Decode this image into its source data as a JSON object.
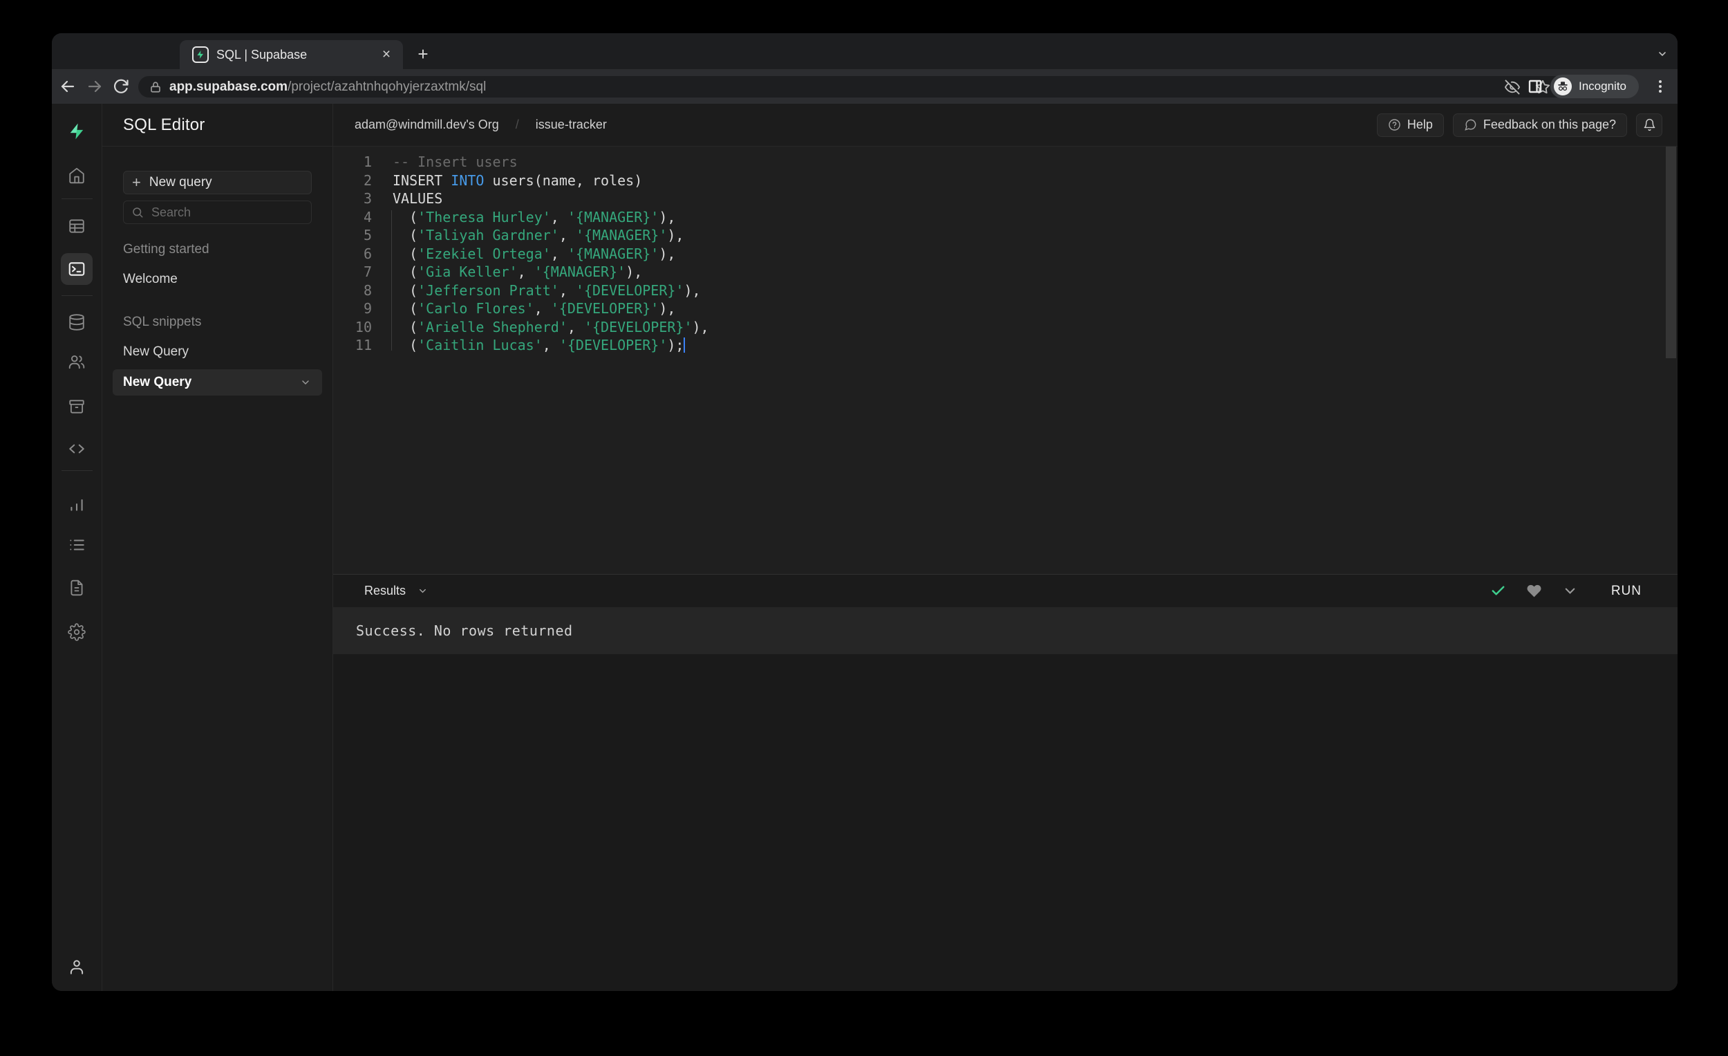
{
  "colors": {
    "accent": "#3ecf8e",
    "keyword_blue": "#479ae8",
    "string_green": "#35a77c",
    "caret_blue": "#3b82f6"
  },
  "browser": {
    "tab_title": "SQL | Supabase",
    "close_tab_glyph": "×",
    "new_tab_glyph": "+",
    "url_domain": "app.supabase.com",
    "url_path": "/project/azahtnhqohyjerzaxtmk/sql",
    "incognito_label": "Incognito"
  },
  "header": {
    "breadcrumb_org": "adam@windmill.dev's Org",
    "breadcrumb_separator": "/",
    "breadcrumb_project": "issue-tracker",
    "help_label": "Help",
    "help_glyph": "?",
    "feedback_label": "Feedback on this page?"
  },
  "sidebar": {
    "panel_title": "SQL Editor",
    "new_query_button": "New query",
    "new_query_plus": "+",
    "search_placeholder": "Search",
    "section1_label": "Getting started",
    "item_welcome": "Welcome",
    "section2_label": "SQL snippets",
    "item_new_query": "New Query",
    "item_new_query_selected": "New Query"
  },
  "editor": {
    "lines": [
      {
        "num": "1",
        "tokens": [
          {
            "t": "-- Insert users",
            "c": "cm"
          }
        ]
      },
      {
        "num": "2",
        "tokens": [
          {
            "t": "INSERT ",
            "c": "pl"
          },
          {
            "t": "INTO",
            "c": "kw"
          },
          {
            "t": " users(name, roles)",
            "c": "pl"
          }
        ]
      },
      {
        "num": "3",
        "tokens": [
          {
            "t": "VALUES",
            "c": "pl"
          }
        ]
      },
      {
        "num": "4",
        "tokens": [
          {
            "t": "  (",
            "c": "pl"
          },
          {
            "t": "'Theresa Hurley'",
            "c": "st"
          },
          {
            "t": ", ",
            "c": "pl"
          },
          {
            "t": "'{MANAGER}'",
            "c": "st"
          },
          {
            "t": "),",
            "c": "pl"
          }
        ]
      },
      {
        "num": "5",
        "tokens": [
          {
            "t": "  (",
            "c": "pl"
          },
          {
            "t": "'Taliyah Gardner'",
            "c": "st"
          },
          {
            "t": ", ",
            "c": "pl"
          },
          {
            "t": "'{MANAGER}'",
            "c": "st"
          },
          {
            "t": "),",
            "c": "pl"
          }
        ]
      },
      {
        "num": "6",
        "tokens": [
          {
            "t": "  (",
            "c": "pl"
          },
          {
            "t": "'Ezekiel Ortega'",
            "c": "st"
          },
          {
            "t": ", ",
            "c": "pl"
          },
          {
            "t": "'{MANAGER}'",
            "c": "st"
          },
          {
            "t": "),",
            "c": "pl"
          }
        ]
      },
      {
        "num": "7",
        "tokens": [
          {
            "t": "  (",
            "c": "pl"
          },
          {
            "t": "'Gia Keller'",
            "c": "st"
          },
          {
            "t": ", ",
            "c": "pl"
          },
          {
            "t": "'{MANAGER}'",
            "c": "st"
          },
          {
            "t": "),",
            "c": "pl"
          }
        ]
      },
      {
        "num": "8",
        "tokens": [
          {
            "t": "  (",
            "c": "pl"
          },
          {
            "t": "'Jefferson Pratt'",
            "c": "st"
          },
          {
            "t": ", ",
            "c": "pl"
          },
          {
            "t": "'{DEVELOPER}'",
            "c": "st"
          },
          {
            "t": "),",
            "c": "pl"
          }
        ]
      },
      {
        "num": "9",
        "tokens": [
          {
            "t": "  (",
            "c": "pl"
          },
          {
            "t": "'Carlo Flores'",
            "c": "st"
          },
          {
            "t": ", ",
            "c": "pl"
          },
          {
            "t": "'{DEVELOPER}'",
            "c": "st"
          },
          {
            "t": "),",
            "c": "pl"
          }
        ]
      },
      {
        "num": "10",
        "tokens": [
          {
            "t": "  (",
            "c": "pl"
          },
          {
            "t": "'Arielle Shepherd'",
            "c": "st"
          },
          {
            "t": ", ",
            "c": "pl"
          },
          {
            "t": "'{DEVELOPER}'",
            "c": "st"
          },
          {
            "t": "),",
            "c": "pl"
          }
        ]
      },
      {
        "num": "11",
        "caret": true,
        "tokens": [
          {
            "t": "  (",
            "c": "pl"
          },
          {
            "t": "'Caitlin Lucas'",
            "c": "st"
          },
          {
            "t": ", ",
            "c": "pl"
          },
          {
            "t": "'{DEVELOPER}'",
            "c": "st"
          },
          {
            "t": ");",
            "c": "pl"
          }
        ]
      }
    ]
  },
  "results": {
    "label": "Results",
    "run_label": "RUN",
    "message": "Success. No rows returned"
  }
}
